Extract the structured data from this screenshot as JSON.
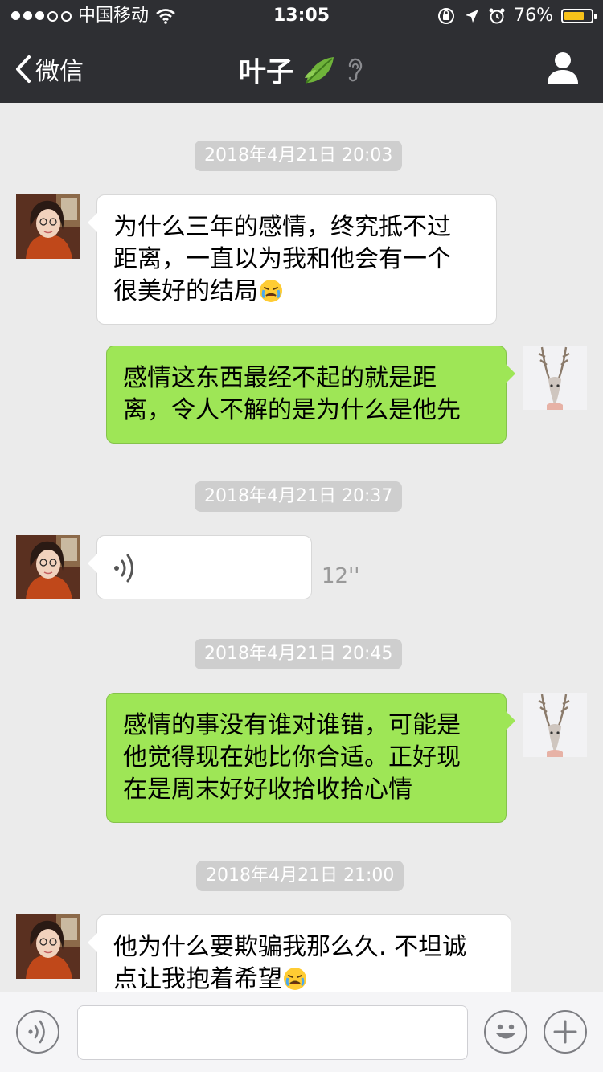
{
  "status_bar": {
    "carrier": "中国移动",
    "time": "13:05",
    "battery_percent_label": "76%",
    "battery_level": 0.76
  },
  "nav": {
    "back_label": "微信",
    "title": "叶子",
    "title_emoji_icon": "leaf-icon",
    "muted_icon": "ear-icon",
    "profile_icon": "person-icon"
  },
  "messages": [
    {
      "type": "timestamp",
      "text": "2018年4月21日 20:03"
    },
    {
      "type": "text",
      "direction": "in",
      "text": "为什么三年的感情，终究抵不过\n距离，一直以为我和他会有一个\n很美好的结局",
      "trailing_emoji": "crying-emoji"
    },
    {
      "type": "text",
      "direction": "out",
      "text": "感情这东西最经不起的就是距\n离，令人不解的是为什么是他先"
    },
    {
      "type": "timestamp",
      "text": "2018年4月21日 20:37"
    },
    {
      "type": "voice",
      "direction": "in",
      "duration": "12''"
    },
    {
      "type": "timestamp",
      "text": "2018年4月21日 20:45"
    },
    {
      "type": "text",
      "direction": "out",
      "text": "感情的事没有谁对谁错，可能是\n他觉得现在她比你合适。正好现\n在是周末好好收拾收拾心情"
    },
    {
      "type": "timestamp",
      "text": "2018年4月21日 21:00"
    },
    {
      "type": "text",
      "direction": "in",
      "text": "他为什么要欺骗我那么久. 不坦诚\n点让我抱着希望",
      "trailing_emoji": "crying-emoji"
    }
  ],
  "input_bar": {
    "voice_icon": "voice-icon",
    "input_value": "",
    "emoji_icon": "smiley-icon",
    "add_icon": "plus-icon"
  },
  "colors": {
    "nav_bg": "#2e2f33",
    "chat_bg": "#ebebeb",
    "outgoing_bubble": "#9ee656",
    "incoming_bubble": "#ffffff",
    "timestamp_bg": "#cecece",
    "battery_fill": "#f7c21a"
  }
}
